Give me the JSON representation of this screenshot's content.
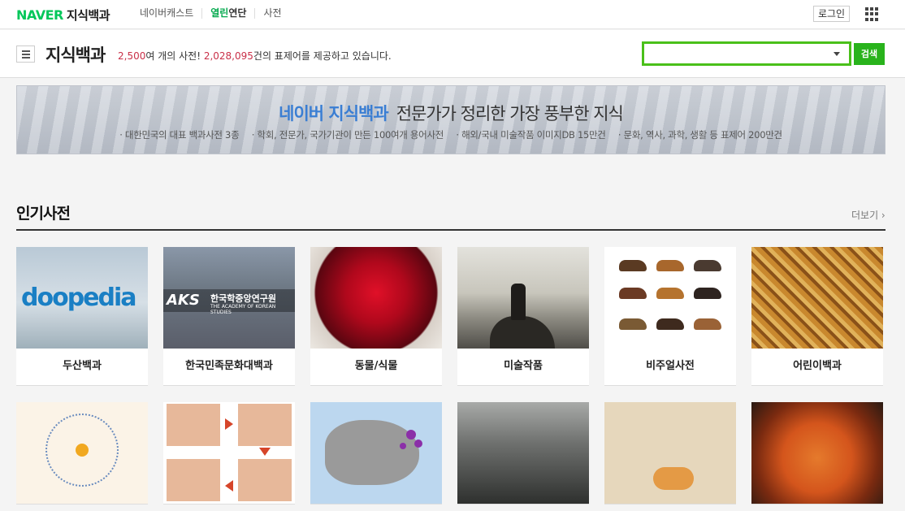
{
  "topbar": {
    "logo": "NAVER",
    "service": "지식백과",
    "nav": [
      {
        "label": "네이버캐스트"
      },
      {
        "label_a": "열린",
        "label_b": "연단"
      },
      {
        "label": "사전"
      }
    ],
    "login": "로그인"
  },
  "header": {
    "title": "지식백과",
    "subtitle_num1": "2,500",
    "subtitle_mid": "여 개의 사전! ",
    "subtitle_num2": "2,028,095",
    "subtitle_end": "건의 표제어를 제공하고 있습니다.",
    "search_value": "",
    "search_button": "검색"
  },
  "banner": {
    "brand": "네이버 지식백과",
    "tagline": "전문가가 정리한 가장 풍부한 지식",
    "points": [
      "· 대한민국의 대표 백과사전 3종",
      "· 학회, 전문가, 국가기관이 만든 100여개 용어사전",
      "· 해외/국내 미술작품 이미지DB 15만건",
      "· 문화, 역사, 과학, 생활 등 표제어 200만건"
    ]
  },
  "popular": {
    "title": "인기사전",
    "more": "더보기 ›",
    "cards": [
      {
        "label": "두산백과",
        "thumb_text": "doopedia"
      },
      {
        "label": "한국민족문화대백과",
        "thumb_ak": "AKS",
        "thumb_kr": "한국학중앙연구원",
        "thumb_en": "THE ACADEMY OF KOREAN STUDIES"
      },
      {
        "label": "동물/식물"
      },
      {
        "label": "미술작품"
      },
      {
        "label": "비주얼사전"
      },
      {
        "label": "어린이백과"
      }
    ]
  },
  "colors": {
    "naver_green": "#03c75a",
    "search_green": "#4ac01a",
    "number_red": "#c93048",
    "brand_blue": "#3a7ed3"
  }
}
